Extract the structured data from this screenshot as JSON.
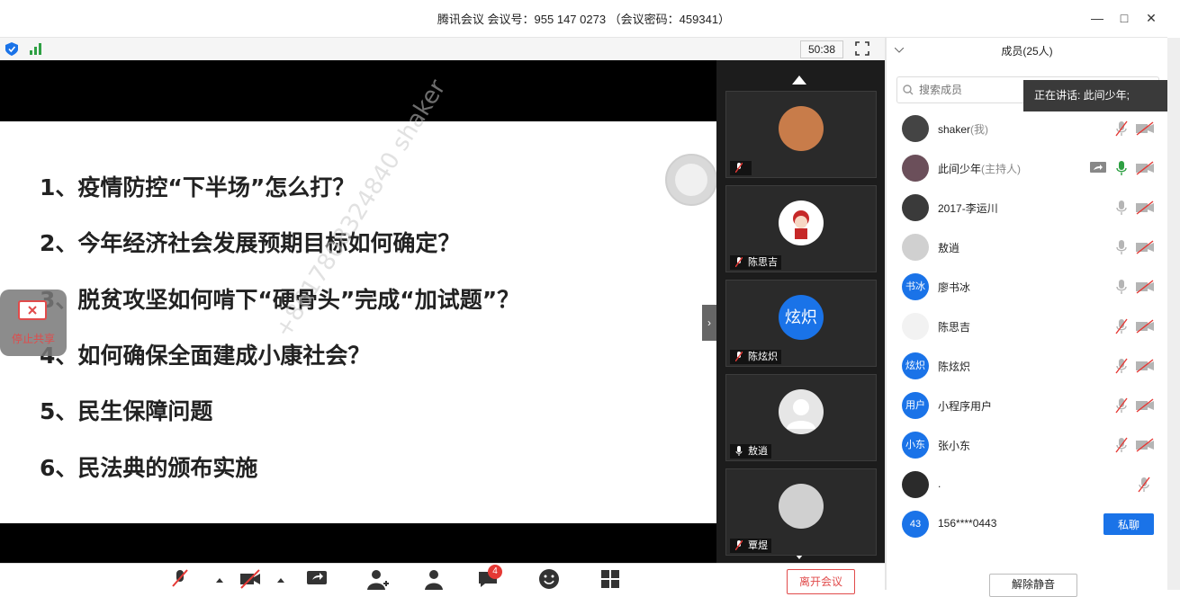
{
  "window": {
    "title": "腾讯会议 会议号：955 147 0273 （会议密码：459341）",
    "minimize": "—",
    "maximize": "□",
    "close": "✕"
  },
  "status": {
    "timer": "50:38"
  },
  "slide": {
    "lines": [
      "1、疫情防控“下半场”怎么打？",
      "2、今年经济社会发展预期目标如何确定？",
      "3、脱贫攻坚如何啃下“硬骨头”完成“加试题”？",
      "4、如何确保全面建成小康社会？",
      "5、民生保障问题",
      "6、民法典的颁布实施"
    ],
    "watermark": "+8617808324840 shaker"
  },
  "stop_share": {
    "label": "停止共享"
  },
  "gallery": {
    "tiles": [
      {
        "name": "",
        "avatar_text": ""
      },
      {
        "name": "陈思吉",
        "avatar_text": ""
      },
      {
        "name": "陈炫炽",
        "avatar_text": "炫炽"
      },
      {
        "name": "敖逍",
        "avatar_text": ""
      },
      {
        "name": "覃煜",
        "avatar_text": ""
      }
    ]
  },
  "panel": {
    "title": "成员(25人)",
    "search_placeholder": "搜索成员",
    "speaking_tip": "正在讲话: 此间少年;",
    "members": [
      {
        "name": "shaker",
        "role": "(我)",
        "avatar": "",
        "color": "#444"
      },
      {
        "name": "此间少年",
        "role": "(主持人)",
        "avatar": "",
        "color": "#6b4f5a"
      },
      {
        "name": "2017-李运川",
        "role": "",
        "avatar": "",
        "color": "#3a3a3a"
      },
      {
        "name": "敖逍",
        "role": "",
        "avatar": "",
        "color": "#d0d0d0"
      },
      {
        "name": "廖书冰",
        "role": "",
        "avatar": "书冰",
        "color": "#1a73e8"
      },
      {
        "name": "陈思吉",
        "role": "",
        "avatar": "",
        "color": "#f2f2f2"
      },
      {
        "name": "陈炫炽",
        "role": "",
        "avatar": "炫炽",
        "color": "#1a73e8"
      },
      {
        "name": "小程序用户",
        "role": "",
        "avatar": "用户",
        "color": "#1a73e8"
      },
      {
        "name": "张小东",
        "role": "",
        "avatar": "小东",
        "color": "#1a73e8"
      },
      {
        "name": ".",
        "role": "",
        "avatar": "",
        "color": "#2b2b2b"
      },
      {
        "name": "156****0443",
        "role": "",
        "avatar": "43",
        "color": "#1a73e8"
      }
    ],
    "private_chat": "私聊",
    "unmute_all": "解除静音"
  },
  "toolbar": {
    "leave": "离开会议",
    "chat_badge": "4"
  }
}
